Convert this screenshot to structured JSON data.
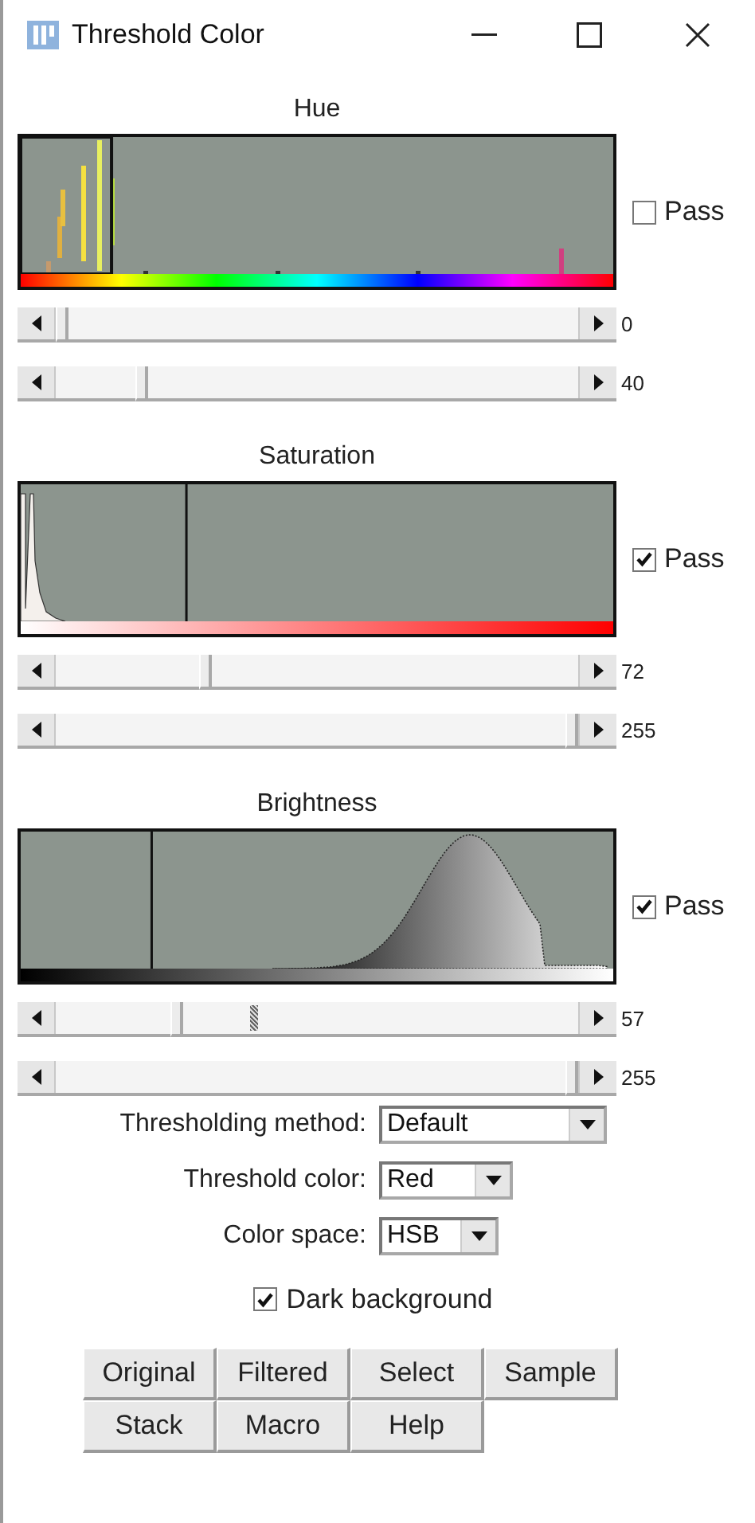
{
  "window": {
    "title": "Threshold Color"
  },
  "sections": [
    {
      "title": "Hue",
      "kind": "hue",
      "pass_label": "Pass",
      "pass": false,
      "sliders": [
        {
          "reading": "0",
          "marker": false
        },
        {
          "reading": "40",
          "marker": false
        }
      ]
    },
    {
      "title": "Saturation",
      "kind": "saturation",
      "pass_label": "Pass",
      "pass": true,
      "sliders": [
        {
          "reading": "72",
          "marker": false
        },
        {
          "reading": "255",
          "marker": false
        }
      ]
    },
    {
      "title": "Brightness",
      "kind": "brightness",
      "pass_label": "Pass",
      "pass": true,
      "sliders": [
        {
          "reading": "57",
          "marker": true
        },
        {
          "reading": "255",
          "marker": false
        }
      ]
    }
  ],
  "options": [
    {
      "label": "Thresholding method:",
      "value": "Default"
    },
    {
      "label": "Threshold color:",
      "value": "Red"
    },
    {
      "label": "Color space:",
      "value": "HSB"
    }
  ],
  "dark_background": {
    "label": "Dark background",
    "checked": true
  },
  "buttons": [
    "Original",
    "Filtered",
    "Select",
    "Sample",
    "Stack",
    "Macro",
    "Help"
  ]
}
